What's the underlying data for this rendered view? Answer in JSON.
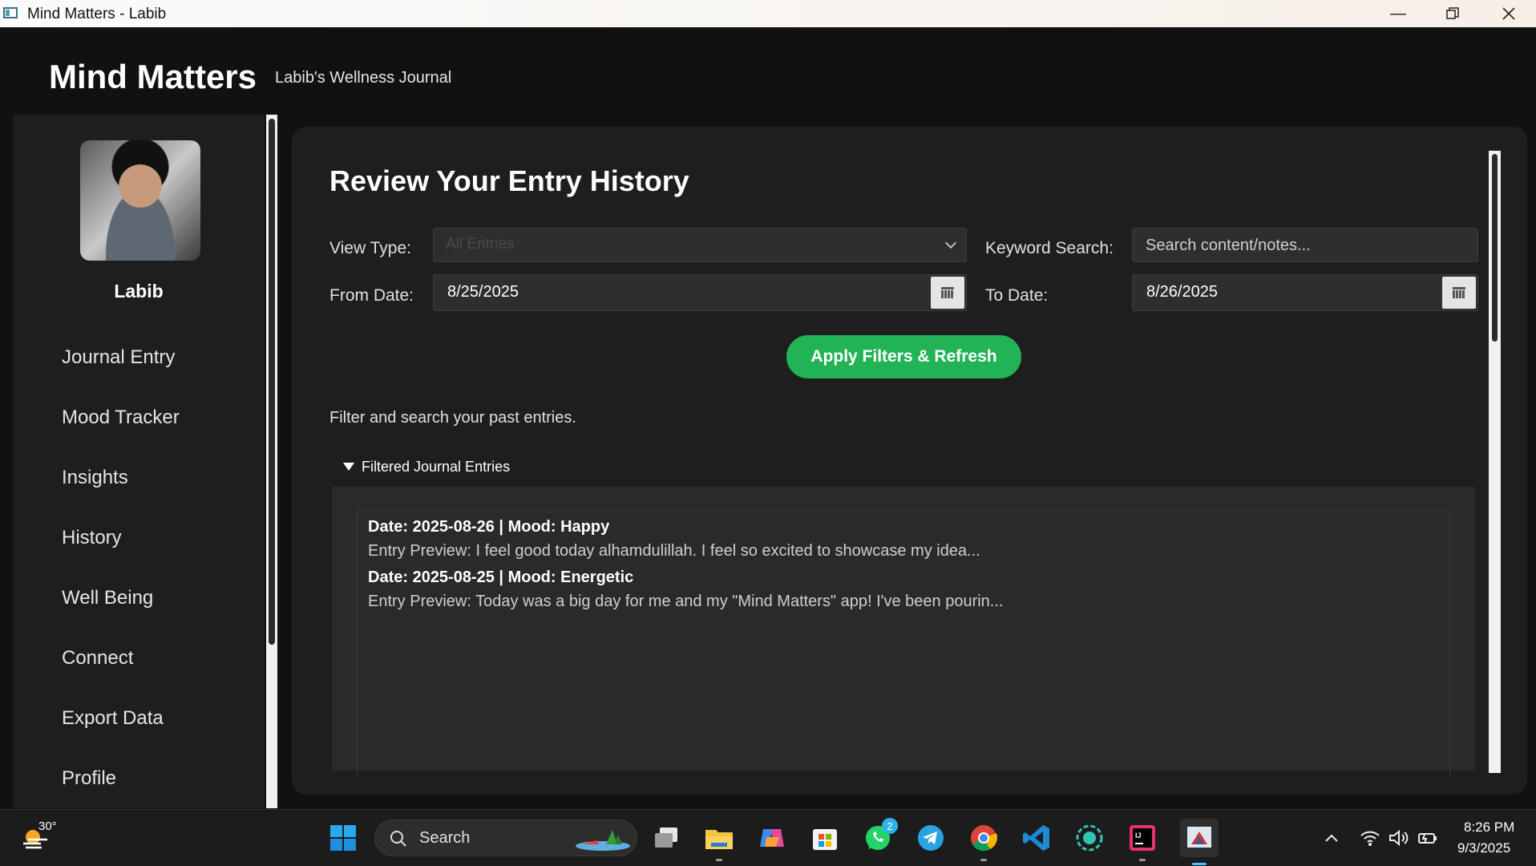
{
  "window": {
    "title": "Mind Matters - Labib"
  },
  "header": {
    "app_title": "Mind Matters",
    "subtitle": "Labib's Wellness Journal"
  },
  "sidebar": {
    "user_name": "Labib",
    "items": [
      {
        "label": "Journal Entry"
      },
      {
        "label": "Mood Tracker"
      },
      {
        "label": "Insights"
      },
      {
        "label": "History"
      },
      {
        "label": "Well Being"
      },
      {
        "label": "Connect"
      },
      {
        "label": "Export Data"
      },
      {
        "label": "Profile"
      }
    ]
  },
  "main": {
    "title": "Review Your Entry History",
    "view_type_label": "View Type:",
    "view_type_value": "All Entries",
    "keyword_label": "Keyword Search:",
    "keyword_placeholder": "Search content/notes...",
    "from_label": "From Date:",
    "from_value": "8/25/2025",
    "to_label": "To Date:",
    "to_value": "8/26/2025",
    "apply_button": "Apply Filters & Refresh",
    "hint": "Filter and search your past entries.",
    "section_title": "Filtered Journal Entries",
    "entries": [
      {
        "header": "Date: 2025-08-26  |  Mood: Happy",
        "preview": "Entry Preview: I feel good today alhamdulillah. I feel so excited to showcase my idea..."
      },
      {
        "header": "Date: 2025-08-25  |  Mood: Energetic",
        "preview": "Entry Preview: Today was a big day for me and my \"Mind Matters\" app! I've been pourin..."
      }
    ]
  },
  "taskbar": {
    "weather_temp": "30°",
    "search_label": "Search",
    "whatsapp_badge": "2",
    "time": "8:26 PM",
    "date": "9/3/2025"
  },
  "colors": {
    "accent_green": "#21b356",
    "panel": "#1e1e1e",
    "background": "#111111"
  }
}
